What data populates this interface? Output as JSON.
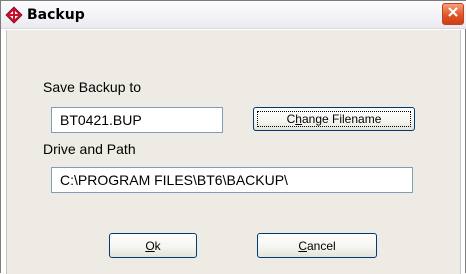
{
  "window": {
    "title": "Backup"
  },
  "form": {
    "save_label": "Save Backup to",
    "filename_value": "BT0421.BUP",
    "change_filename": {
      "prefix": "C",
      "accel": "h",
      "rest": "ange Filename"
    },
    "drive_label": "Drive and Path",
    "path_value": "C:\\PROGRAM FILES\\BT6\\BACKUP\\"
  },
  "buttons": {
    "ok": {
      "accel": "O",
      "rest": "k"
    },
    "cancel": {
      "accel": "C",
      "rest": "ancel"
    }
  },
  "icons": {
    "app": "diamond-logo-icon",
    "close": "close-icon"
  },
  "colors": {
    "close_button": "#e0542a",
    "client_background": "#edebe4",
    "button_border": "#003c74",
    "textbox_border": "#7f9db9"
  }
}
